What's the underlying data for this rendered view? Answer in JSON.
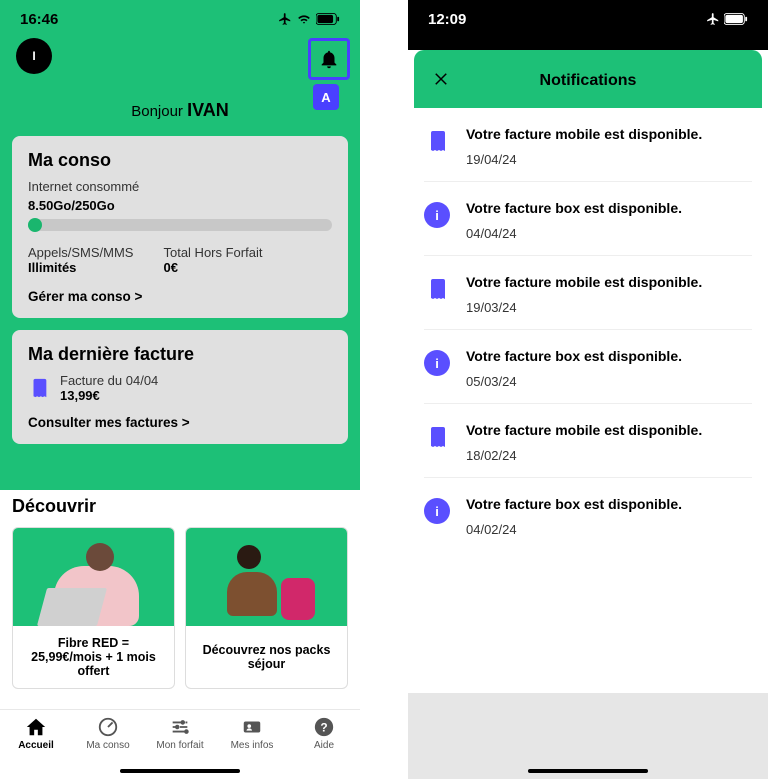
{
  "left": {
    "status_time": "16:46",
    "avatar_initial": "I",
    "badge_letter": "A",
    "greeting_prefix": "Bonjour",
    "greeting_name": "IVAN",
    "conso": {
      "title": "Ma conso",
      "internet_label": "Internet consommé",
      "internet_usage": "8.50Go/250Go",
      "calls_label": "Appels/SMS/MMS",
      "calls_value": "Illimités",
      "offplan_label": "Total Hors Forfait",
      "offplan_value": "0€",
      "manage_link": "Gérer ma conso >"
    },
    "invoice": {
      "title": "Ma dernière facture",
      "line1": "Facture du 04/04",
      "amount": "13,99€",
      "link": "Consulter mes factures >"
    },
    "discover": {
      "title": "Découvrir",
      "promo1": "Fibre RED = 25,99€/mois + 1 mois offert",
      "promo2": "Découvrez nos packs séjour"
    },
    "tabs": {
      "accueil": "Accueil",
      "conso": "Ma conso",
      "forfait": "Mon forfait",
      "infos": "Mes infos",
      "aide": "Aide"
    }
  },
  "right": {
    "status_time": "12:09",
    "title": "Notifications",
    "items": [
      {
        "type": "doc",
        "msg": "Votre facture mobile est disponible.",
        "date": "19/04/24"
      },
      {
        "type": "info",
        "msg": "Votre facture box est disponible.",
        "date": "04/04/24"
      },
      {
        "type": "doc",
        "msg": "Votre facture mobile est disponible.",
        "date": "19/03/24"
      },
      {
        "type": "info",
        "msg": "Votre facture box est disponible.",
        "date": "05/03/24"
      },
      {
        "type": "doc",
        "msg": "Votre facture mobile est disponible.",
        "date": "18/02/24"
      },
      {
        "type": "info",
        "msg": "Votre facture box est disponible.",
        "date": "04/02/24"
      }
    ]
  }
}
